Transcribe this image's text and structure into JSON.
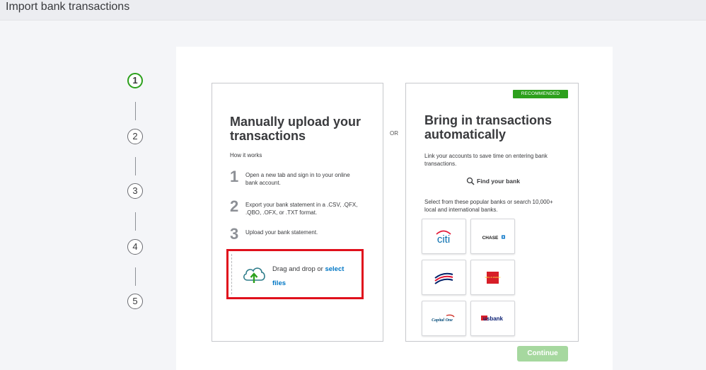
{
  "header": {
    "title": "Import bank transactions"
  },
  "stepper": {
    "steps": [
      "1",
      "2",
      "3",
      "4",
      "5"
    ],
    "active_step": "1"
  },
  "manual": {
    "title_line1": "Manually upload your",
    "title_line2": "transactions",
    "how_it_works": "How it works",
    "steps": [
      {
        "num": "1",
        "text": "Open a new tab and sign in to your online bank account."
      },
      {
        "num": "2",
        "text": "Export your bank statement in a .CSV, .QFX, .QBO, .OFX, or .TXT format."
      },
      {
        "num": "3",
        "text": "Upload your bank statement."
      }
    ],
    "dropzone": {
      "text": "Drag and drop or ",
      "link": "select files"
    }
  },
  "or_label": "OR",
  "automatic": {
    "badge": "RECOMMENDED",
    "title_line1": "Bring in transactions",
    "title_line2": "automatically",
    "description": "Link your accounts to save time on entering bank transactions.",
    "find_bank": "Find your bank",
    "popular": "Select from these popular banks or search 10,000+ local and international banks.",
    "banks": [
      {
        "name": "citi",
        "label": "citi"
      },
      {
        "name": "chase",
        "label": "CHASE"
      },
      {
        "name": "bank-of-america",
        "label": ""
      },
      {
        "name": "wells-fargo",
        "label": "WELLS FARGO"
      },
      {
        "name": "capital-one",
        "label": "Capital One"
      },
      {
        "name": "us-bank",
        "label": "usbank"
      }
    ]
  },
  "footer": {
    "continue_label": "Continue"
  },
  "colors": {
    "accent": "#2ca01c",
    "link": "#0077c5",
    "highlight": "#e0101c",
    "button_disabled": "#a6d89f"
  }
}
